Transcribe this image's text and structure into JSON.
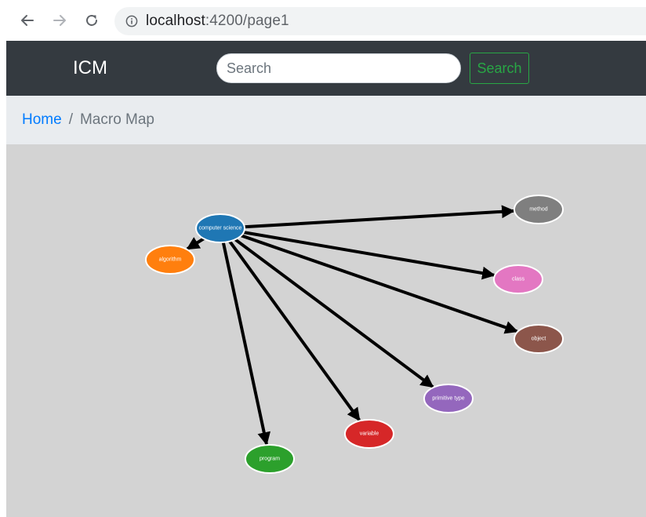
{
  "browser": {
    "url_host": "localhost",
    "url_rest": ":4200/page1"
  },
  "navbar": {
    "brand": "ICM",
    "search_placeholder": "Search",
    "search_button": "Search"
  },
  "breadcrumb": {
    "separator": "/",
    "items": [
      "Home",
      "Macro Map"
    ]
  },
  "map": {
    "background": "#d3d3d3",
    "edge_color": "#000000",
    "nodes": [
      {
        "id": "computer-science",
        "label": "computer science",
        "color": "#1f77b4"
      },
      {
        "id": "algorithm",
        "label": "algorithm",
        "color": "#ff7f0e"
      },
      {
        "id": "method",
        "label": "method",
        "color": "#7f7f7f"
      },
      {
        "id": "class",
        "label": "class",
        "color": "#e377c2"
      },
      {
        "id": "object",
        "label": "object",
        "color": "#8c564b"
      },
      {
        "id": "primitive-type",
        "label": "primitive type",
        "color": "#9467bd"
      },
      {
        "id": "variable",
        "label": "variable",
        "color": "#d62728"
      },
      {
        "id": "program",
        "label": "program",
        "color": "#2ca02c"
      }
    ],
    "edges": [
      {
        "from": "computer-science",
        "to": "algorithm"
      },
      {
        "from": "computer-science",
        "to": "method"
      },
      {
        "from": "computer-science",
        "to": "class"
      },
      {
        "from": "computer-science",
        "to": "object"
      },
      {
        "from": "computer-science",
        "to": "primitive-type"
      },
      {
        "from": "computer-science",
        "to": "variable"
      },
      {
        "from": "computer-science",
        "to": "program"
      }
    ]
  }
}
